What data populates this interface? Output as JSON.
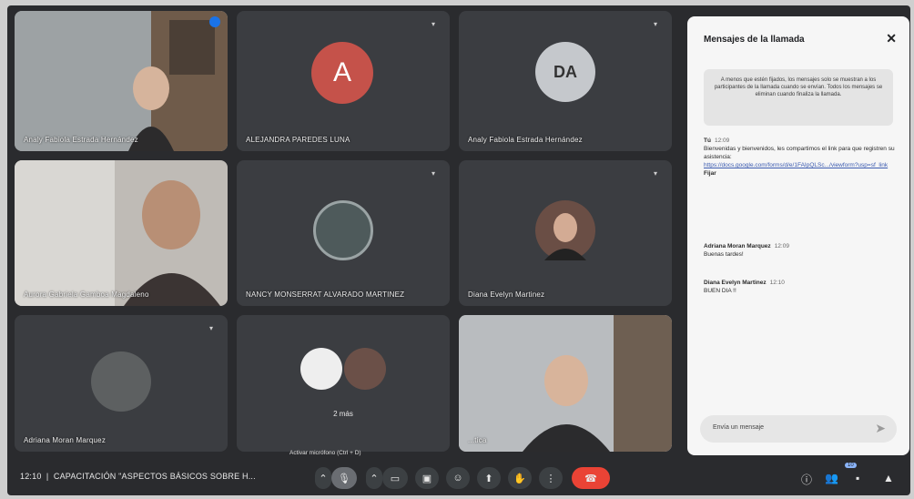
{
  "participants": [
    {
      "name": "Analy Fabiola Estrada Hernández",
      "display": "Analy Fabiola Estrada Hernández",
      "type": "video"
    },
    {
      "name": "ALEJANDRA PAREDES LUNA",
      "initial": "A",
      "avatar_color": "#c5524a",
      "type": "avatar"
    },
    {
      "name": "Analy Fabiola Estrada Hernández",
      "initial": "DA",
      "avatar_color": "#c5c8cc",
      "type": "avatar-logo"
    },
    {
      "name": "Aurora Gabriela Gamboa Magdaleno",
      "type": "video"
    },
    {
      "name": "NANCY MONSERRAT ALVARADO MARTINEZ",
      "type": "avatar-photo"
    },
    {
      "name": "Diana Evelyn Martinez",
      "type": "avatar-photo"
    },
    {
      "name": "Adriana Moran Marquez",
      "type": "avatar-photo"
    },
    {
      "name": "2 más",
      "type": "group"
    },
    {
      "name": "...tica",
      "type": "video"
    }
  ],
  "chat": {
    "title": "Mensajes de la llamada",
    "notice": "A menos que estén fijados, los mensajes solo se muestran a los participantes de la llamada cuando se envían. Todos los mensajes se eliminan cuando finaliza la llamada.",
    "messages": [
      {
        "author": "Tú",
        "time": "12:09",
        "text": "Bienvenidas y bienvenidos, les compartimos el link para que registren su asistencia:",
        "link": "https://docs.google.com/forms/d/e/1FAIpQLSc.../viewform?usp=sf_link",
        "extra": "Fijar"
      },
      {
        "author": "Adriana Moran Marquez",
        "time": "12:09",
        "text": "Buenas tardes!"
      },
      {
        "author": "Diana Evelyn Martinez",
        "time": "12:10",
        "text": "BUEN DIA !!"
      }
    ],
    "input_placeholder": "Envía un mensaje"
  },
  "bottom_bar": {
    "time": "12:10",
    "meeting_title": "CAPACITACIÓN \"ASPECTOS BÁSICOS SOBRE H...",
    "mic_tooltip": "Activar micrófono (Ctrl + D)",
    "people_count": "10"
  },
  "colors": {
    "background": "#2a2b2e",
    "tile": "#3b3d41",
    "end_call": "#ea4335",
    "accent": "#8ab4f8"
  }
}
